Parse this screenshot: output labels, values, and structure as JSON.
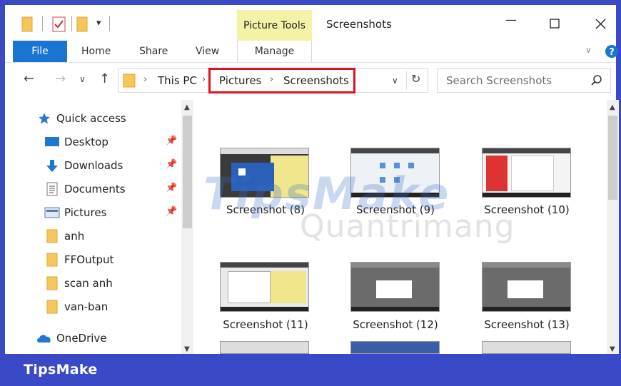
{
  "window": {
    "title": "Screenshots",
    "contextual_group": "Picture Tools"
  },
  "ribbon": {
    "tabs": [
      {
        "label": "File"
      },
      {
        "label": "Home"
      },
      {
        "label": "Share"
      },
      {
        "label": "View"
      },
      {
        "label": "Manage"
      }
    ]
  },
  "address": {
    "crumbs": [
      "This PC",
      "Pictures",
      "Screenshots"
    ],
    "search_placeholder": "Search Screenshots"
  },
  "sidebar": {
    "items": [
      {
        "label": "Quick access",
        "icon": "star-icon",
        "pinned": false
      },
      {
        "label": "Desktop",
        "icon": "desktop-icon",
        "pinned": true
      },
      {
        "label": "Downloads",
        "icon": "download-arrow-icon",
        "pinned": true
      },
      {
        "label": "Documents",
        "icon": "document-icon",
        "pinned": true
      },
      {
        "label": "Pictures",
        "icon": "pictures-icon",
        "pinned": true
      },
      {
        "label": "anh",
        "icon": "folder-icon",
        "pinned": false
      },
      {
        "label": "FFOutput",
        "icon": "folder-icon",
        "pinned": false
      },
      {
        "label": "scan anh",
        "icon": "folder-icon",
        "pinned": false
      },
      {
        "label": "van-ban",
        "icon": "folder-icon",
        "pinned": false
      },
      {
        "label": "OneDrive",
        "icon": "cloud-icon",
        "pinned": false
      }
    ]
  },
  "files": [
    {
      "name": "Screenshot (8)"
    },
    {
      "name": "Screenshot (9)"
    },
    {
      "name": "Screenshot (10)"
    },
    {
      "name": "Screenshot (11)"
    },
    {
      "name": "Screenshot (12)"
    },
    {
      "name": "Screenshot (13)"
    }
  ],
  "watermark": {
    "line1": "TipsMake",
    "line2": "Quantrimang"
  },
  "footer": {
    "brand": "TipsMake"
  },
  "colors": {
    "frame": "#3a49c6",
    "file_tab": "#1a74d2",
    "contextual_tab": "#f4f2a6",
    "highlight": "#e10f1f"
  }
}
